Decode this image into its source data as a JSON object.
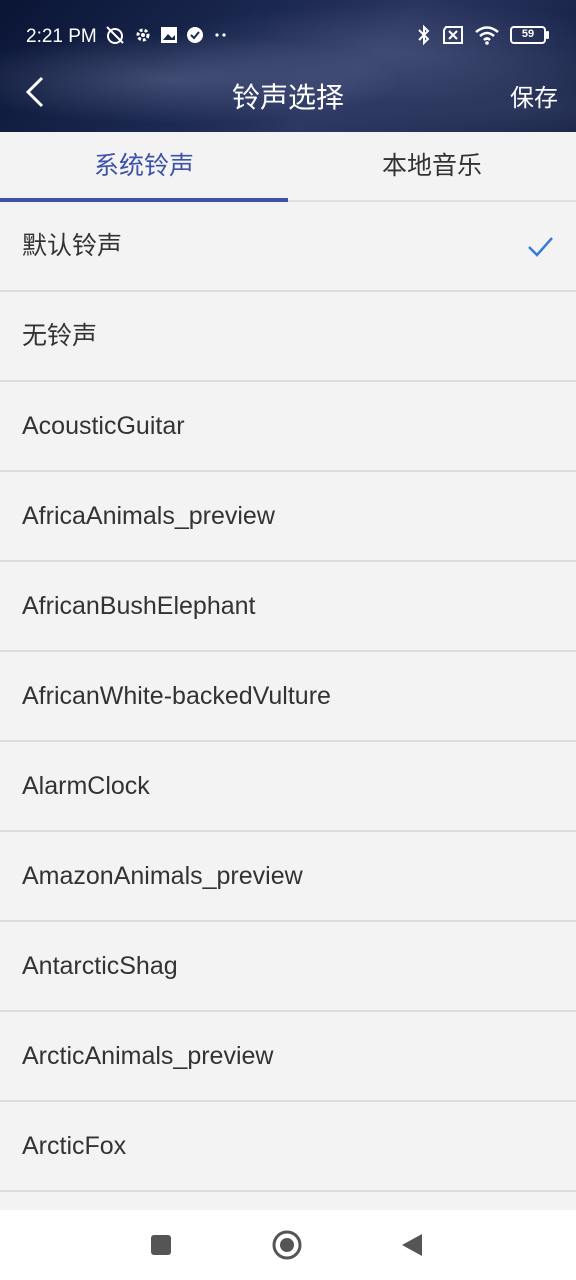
{
  "status": {
    "time": "2:21 PM",
    "battery": "59"
  },
  "header": {
    "title": "铃声选择",
    "save_label": "保存"
  },
  "tabs": [
    {
      "label": "系统铃声",
      "active": true
    },
    {
      "label": "本地音乐",
      "active": false
    }
  ],
  "ringtones": [
    {
      "label": "默认铃声",
      "selected": true
    },
    {
      "label": "无铃声"
    },
    {
      "label": "AcousticGuitar"
    },
    {
      "label": "AfricaAnimals_preview"
    },
    {
      "label": "AfricanBushElephant"
    },
    {
      "label": "AfricanWhite-backedVulture"
    },
    {
      "label": "AlarmClock"
    },
    {
      "label": "AmazonAnimals_preview"
    },
    {
      "label": "AntarcticShag"
    },
    {
      "label": "ArcticAnimals_preview"
    },
    {
      "label": "ArcticFox"
    }
  ],
  "colors": {
    "accent": "#3e52a8",
    "check": "#3a7bd5"
  }
}
